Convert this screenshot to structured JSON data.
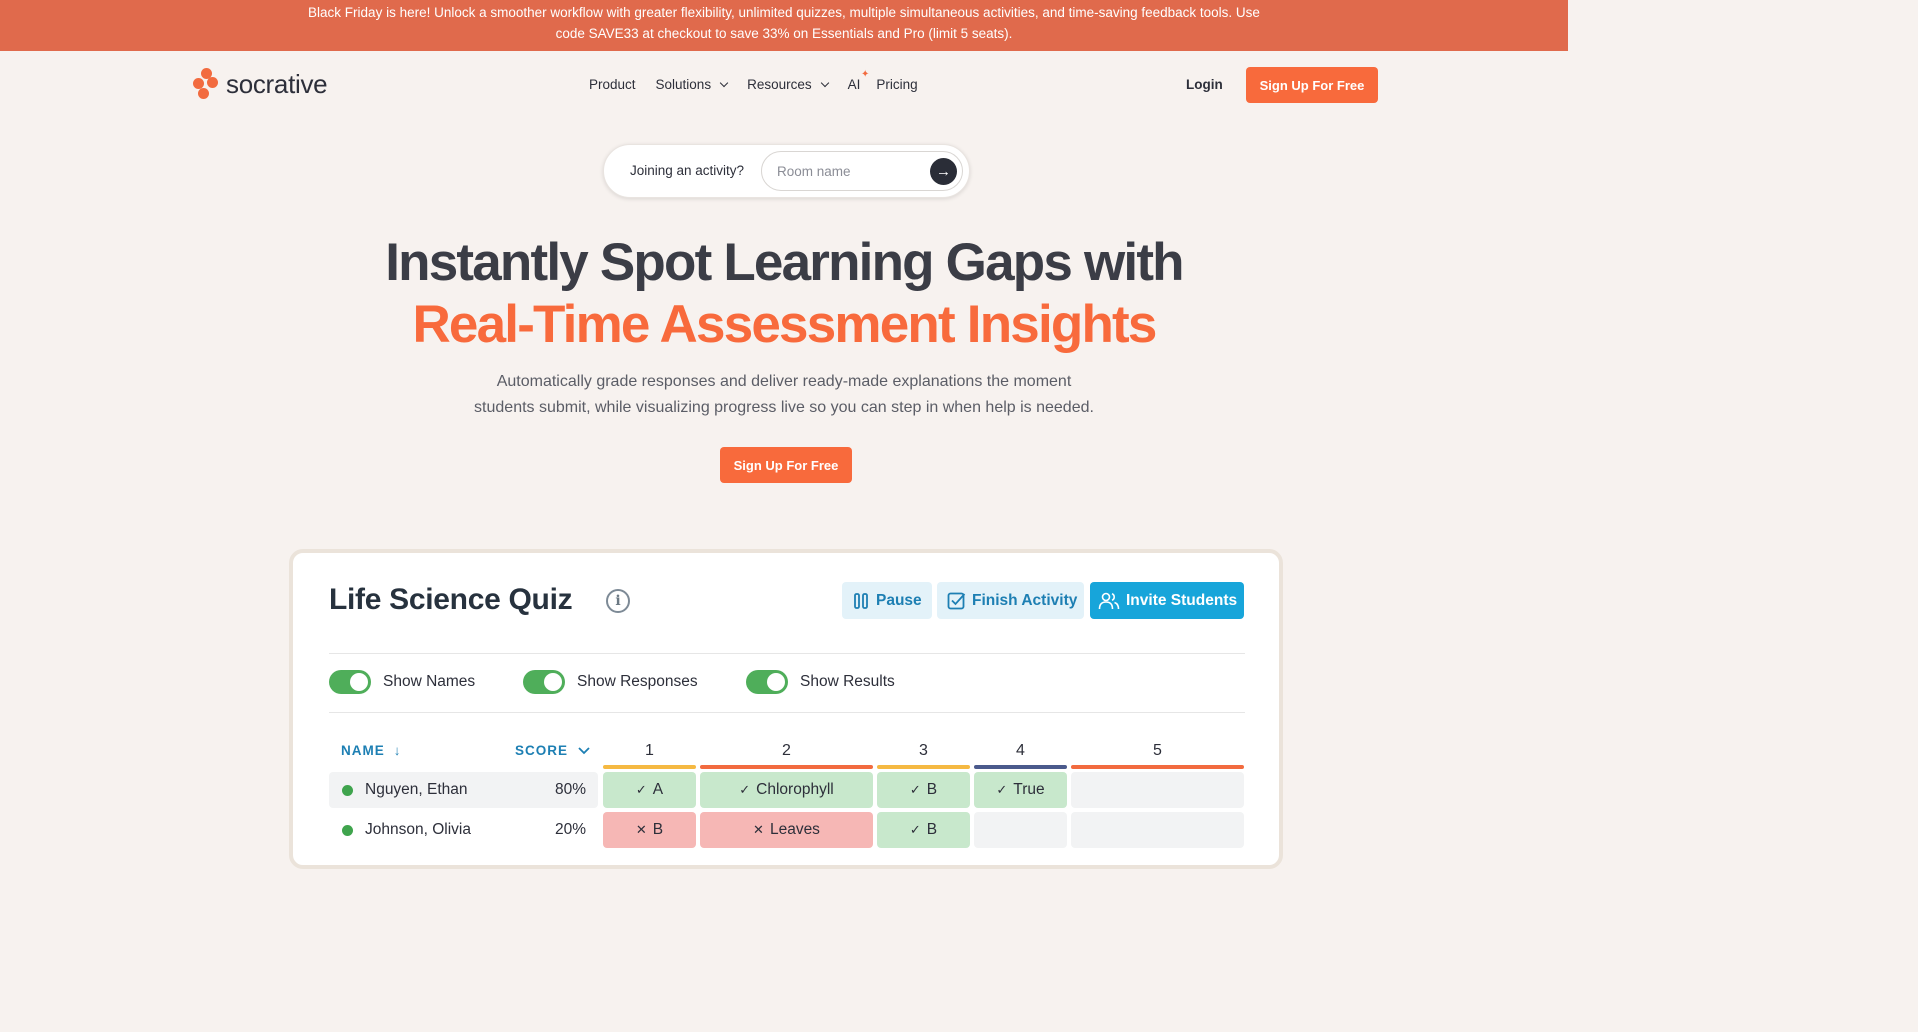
{
  "promo": {
    "line1": "Black Friday is here! Unlock a smoother workflow with greater flexibility, unlimited quizzes, multiple simultaneous activities, and time-saving feedback tools. Use",
    "line2": "code SAVE33 at checkout to save 33% on Essentials and Pro (limit 5 seats)."
  },
  "nav": {
    "logo": "socrative",
    "links": [
      "Product",
      "Solutions",
      "Resources",
      "AI",
      "Pricing"
    ],
    "login": "Login",
    "cta": "Sign Up For Free"
  },
  "join": {
    "label": "Joining an activity?",
    "placeholder": "Room name",
    "value": ""
  },
  "hero": {
    "title_line1": "Instantly Spot Learning Gaps with",
    "title_line2": "Real-Time Assessment Insights",
    "subtitle_line1": "Automatically grade responses and deliver ready-made explanations the moment",
    "subtitle_line2": "students submit, while visualizing progress live so you can step in when help is needed.",
    "cta": "Sign Up For Free"
  },
  "quiz": {
    "title": "Life Science Quiz",
    "actions": {
      "pause": "Pause",
      "finish": "Finish Activity",
      "invite": "Invite Students"
    },
    "toggles": [
      {
        "label": "Show Names",
        "on": true
      },
      {
        "label": "Show Responses",
        "on": true
      },
      {
        "label": "Show Results",
        "on": true
      }
    ],
    "columns": {
      "name": "NAME",
      "score": "SCORE",
      "questions": [
        "1",
        "2",
        "3",
        "4",
        "5"
      ]
    },
    "question_colors": [
      "#f5b942",
      "#f26b3f",
      "#f5b942",
      "#4b5a8c",
      "#f26b3f"
    ],
    "rows": [
      {
        "name": "Nguyen, Ethan",
        "score": "80%",
        "answers": [
          {
            "text": "A",
            "result": "correct"
          },
          {
            "text": "Chlorophyll",
            "result": "correct"
          },
          {
            "text": "B",
            "result": "correct"
          },
          {
            "text": "True",
            "result": "correct"
          },
          {
            "text": "",
            "result": "empty"
          }
        ]
      },
      {
        "name": "Johnson, Olivia",
        "score": "20%",
        "answers": [
          {
            "text": "B",
            "result": "incorrect"
          },
          {
            "text": "Leaves",
            "result": "incorrect"
          },
          {
            "text": "B",
            "result": "correct"
          },
          {
            "text": "",
            "result": "empty"
          },
          {
            "text": "",
            "result": "empty"
          }
        ]
      }
    ]
  }
}
